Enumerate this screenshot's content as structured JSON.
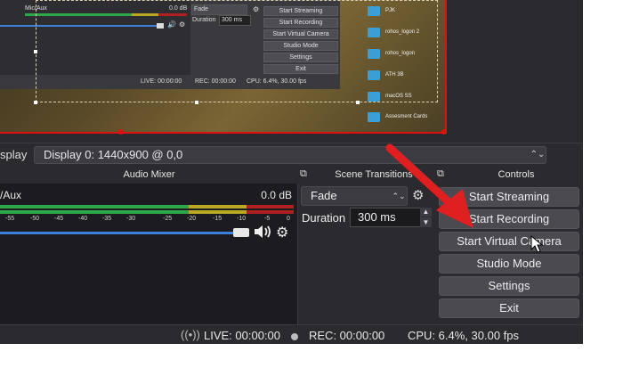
{
  "preview": {
    "nested": {
      "mixer_label": "Mic/Aux",
      "mixer_db": "0.0 dB",
      "transition": "Fade",
      "duration_label": "Duration",
      "duration_value": "300 ms",
      "buttons": [
        "Start Streaming",
        "Start Recording",
        "Start Virtual Camera",
        "Studio Mode",
        "Settings",
        "Exit"
      ],
      "status": {
        "live": "LIVE: 00:00:00",
        "rec": "REC: 00:00:00",
        "cpu": "CPU: 6.4%, 30.00 fps"
      }
    },
    "folders": [
      "PJK",
      "rohos_logon 2",
      "rohos_logon",
      "ATH 3B",
      "macOS SS",
      "Assesment Cards"
    ]
  },
  "scene_bar": {
    "label": "splay",
    "display_value": "Display 0: 1440x900 @ 0,0"
  },
  "audio_mixer": {
    "title": "Audio Mixer",
    "channel_label": "/Aux",
    "channel_db": "0.0 dB",
    "ticks": [
      "-55",
      "-50",
      "-45",
      "-40",
      "-35",
      "-30",
      "-25",
      "-20",
      "-15",
      "-10",
      "-5",
      "0"
    ],
    "volume_level": 0.93
  },
  "scene_transitions": {
    "title": "Scene Transitions",
    "transition_value": "Fade",
    "duration_label": "Duration",
    "duration_value": "300 ms"
  },
  "controls": {
    "title": "Controls",
    "buttons": [
      "Start Streaming",
      "Start Recording",
      "Start Virtual Camera",
      "Studio Mode",
      "Settings",
      "Exit"
    ]
  },
  "status_bar": {
    "live": "LIVE: 00:00:00",
    "rec": "REC: 00:00:00",
    "cpu": "CPU: 6.4%, 30.00 fps"
  },
  "colors": {
    "arrow": "#e02020",
    "selection_border": "#d11111",
    "meter_green": "#2fa84a",
    "meter_yellow": "#b8a824",
    "meter_red": "#b02020",
    "volume_track": "#3b82d8"
  }
}
